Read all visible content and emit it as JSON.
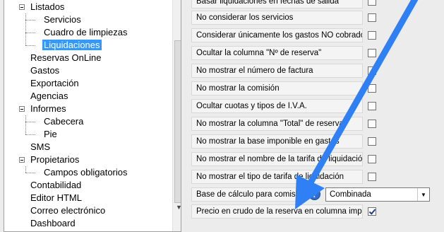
{
  "tree": {
    "items": [
      {
        "label": "Listados",
        "expanded": true
      },
      {
        "label": "Servicios"
      },
      {
        "label": "Cuadro de limpiezas"
      },
      {
        "label": "Liquidaciones",
        "selected": true
      },
      {
        "label": "Reservas OnLine"
      },
      {
        "label": "Gastos"
      },
      {
        "label": "Exportación"
      },
      {
        "label": "Agencias"
      },
      {
        "label": "Informes",
        "expanded": true
      },
      {
        "label": "Cabecera"
      },
      {
        "label": "Pie"
      },
      {
        "label": "SMS"
      },
      {
        "label": "Propietarios",
        "expanded": true
      },
      {
        "label": "Campos obligatorios"
      },
      {
        "label": "Contabilidad"
      },
      {
        "label": "Editor HTML"
      },
      {
        "label": "Correo electrónico"
      },
      {
        "label": "Dashboard"
      }
    ]
  },
  "options": [
    {
      "label": "Basar liquidaciones en fechas de salida",
      "checked": false
    },
    {
      "label": "No considerar los servicios",
      "checked": false
    },
    {
      "label": "Considerar únicamente los gastos NO cobrados",
      "checked": false
    },
    {
      "label": "Ocultar la columna \"Nº de reserva\"",
      "checked": false
    },
    {
      "label": "No mostrar el número de factura",
      "checked": false
    },
    {
      "label": "No mostrar la comisión",
      "checked": false
    },
    {
      "label": "Ocultar cuotas y tipos de I.V.A.",
      "checked": false
    },
    {
      "label": "No mostrar la columna \"Total\" de reserva",
      "checked": false
    },
    {
      "label": "No mostrar la base imponible en gastos",
      "checked": false
    },
    {
      "label": "No mostrar el nombre de la tarifa de liquidación",
      "checked": false
    },
    {
      "label": "No mostrar el tipo de tarifa de liquidación",
      "checked": false
    }
  ],
  "base_calculo": {
    "label": "Base de cálculo para comisiones",
    "help_glyph": "?",
    "value": "Combinada"
  },
  "precio_crudo": {
    "label": "Precio en crudo de la reserva en columna importe",
    "checked": true
  },
  "colors": {
    "selection": "#3399ff",
    "annotation_arrow": "#2f7ff5"
  },
  "icons": {
    "combo_arrow": "▼",
    "scroll_down": "▼"
  }
}
